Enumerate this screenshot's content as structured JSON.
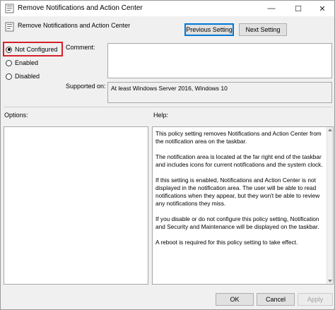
{
  "window": {
    "title": "Remove Notifications and Action Center",
    "minimize": "—",
    "maximize": "☐",
    "close": "✕"
  },
  "header": {
    "title": "Remove Notifications and Action Center"
  },
  "nav": {
    "previous_label": "Previous Setting",
    "next_label": "Next Setting"
  },
  "state": {
    "options": [
      {
        "label": "Not Configured",
        "checked": true
      },
      {
        "label": "Enabled",
        "checked": false
      },
      {
        "label": "Disabled",
        "checked": false
      }
    ]
  },
  "fields": {
    "comment_label": "Comment:",
    "comment_value": "",
    "supported_label": "Supported on:",
    "supported_value": "At least Windows Server 2016, Windows 10"
  },
  "panels": {
    "options_label": "Options:",
    "help_label": "Help:",
    "help_paragraphs": [
      "This policy setting removes Notifications and Action Center from the notification area on the taskbar.",
      "The notification area is located at the far right end of the taskbar and includes icons for current notifications and the system clock.",
      "If this setting is enabled, Notifications and Action Center is not displayed in the notification area. The user will be able to read notifications when they appear, but they won't be able to review any notifications they miss.",
      "If you disable or do not configure this policy setting, Notification and Security and Maintenance will be displayed on the taskbar.",
      "A reboot is required for this policy setting to take effect."
    ]
  },
  "footer": {
    "ok_label": "OK",
    "cancel_label": "Cancel",
    "apply_label": "Apply"
  },
  "colors": {
    "highlight": "#d6202b",
    "focus": "#0078d7"
  }
}
